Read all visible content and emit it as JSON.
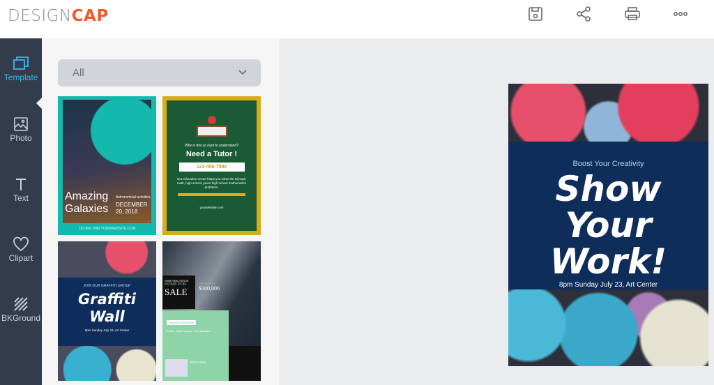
{
  "header": {
    "logo_design": "DESIGN",
    "logo_cap": "CAP",
    "actions": [
      {
        "icon": "save-icon"
      },
      {
        "icon": "share-icon"
      },
      {
        "icon": "print-icon"
      },
      {
        "icon": "more-icon"
      }
    ]
  },
  "sidebar": {
    "items": [
      {
        "label": "Template",
        "icon": "template-icon",
        "active": true
      },
      {
        "label": "Photo",
        "icon": "photo-icon"
      },
      {
        "label": "Text",
        "icon": "text-icon"
      },
      {
        "label": "Clipart",
        "icon": "heart-icon"
      },
      {
        "label": "BKGround",
        "icon": "background-icon"
      }
    ]
  },
  "panel": {
    "filter": "All",
    "templates": [
      {
        "title1": "Amazing",
        "title2": "Galaxies",
        "side": "Astronomical activities",
        "date1": "DECEMBER",
        "date2": "20, 2018",
        "footer": "123 456 7890   YOURWEBSITE.COM"
      },
      {
        "question": "Why is this so hard to understand?",
        "title": "Need a Tutor !",
        "phone": "123-456-7890",
        "body": "Our education center helps you solve the Olympic math, high school, junior high school mathematics problems.",
        "website": "yourwebsite.com"
      },
      {
        "kicker": "JOIN OUR GRAFFITI GROUP",
        "title1": "Graffiti",
        "title2": "Wall",
        "date": "8pm Sunday July 23, Art Center"
      },
      {
        "label": "HOME REAL ESTATE",
        "title1": "HOME FOR",
        "title2": "SALE",
        "offered": "OFFERED AT",
        "price": "$100,000",
        "features": "HOUSE FEATURES",
        "sqft": "2,500 - 5,000 Square Feet Available",
        "agent": "RYAN COOK"
      }
    ]
  },
  "canvas": {
    "subtitle": "Boost Your Creativity",
    "title_lines": [
      "Show",
      "Your",
      "Work!"
    ],
    "date": "8pm Sunday July 23, Art Center"
  },
  "colors": {
    "accent": "#3bb7e8",
    "brand": "#f05a28",
    "sidebar": "#323c4b",
    "navy": "#0f2d5a"
  }
}
